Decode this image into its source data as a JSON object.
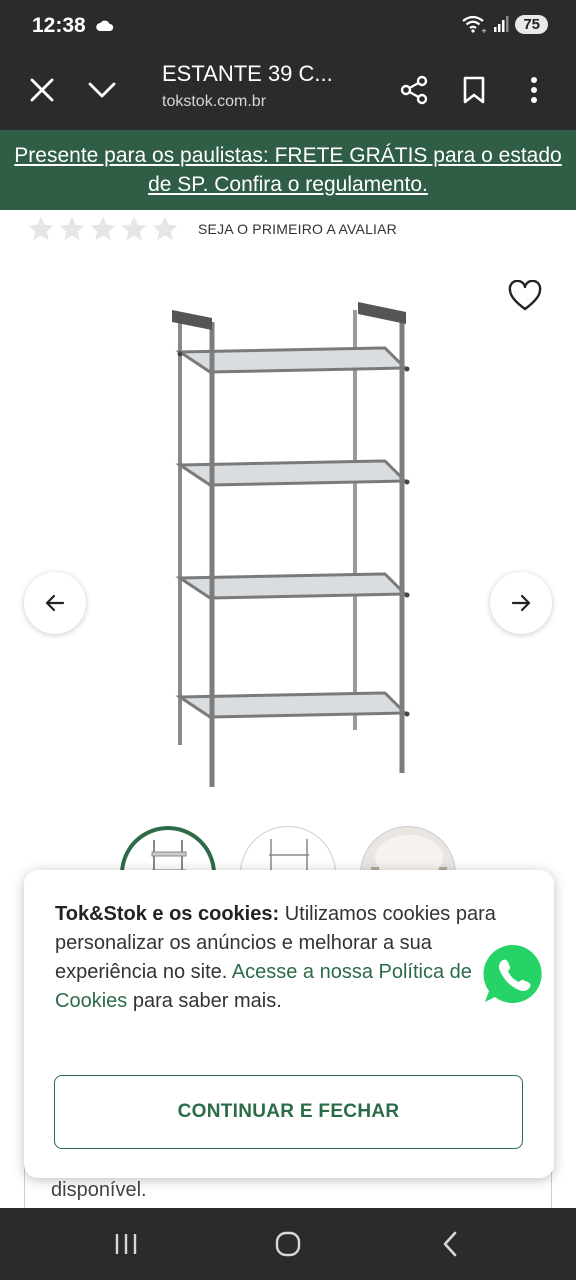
{
  "status_bar": {
    "time": "12:38",
    "battery": "75",
    "icons": [
      "cloud-icon",
      "wifi-icon",
      "signal-icon",
      "battery-icon"
    ]
  },
  "toolbar": {
    "title": "ESTANTE 39 C...",
    "url": "tokstok.com.br",
    "icons": [
      "close-icon",
      "chevron-down-icon",
      "share-icon",
      "bookmark-icon",
      "more-vert-icon"
    ]
  },
  "promo": {
    "text": "Presente para os paulistas: FRETE GRÁTIS para o estado de SP. Confira o regulamento."
  },
  "rating": {
    "stars_filled": 0,
    "stars_total": 5,
    "label": "SEJA O PRIMEIRO A AVALIAR"
  },
  "product": {
    "image_icon": "metal-glass-shelf",
    "thumbnail_count": 3,
    "active_thumbnail": 1
  },
  "cookie": {
    "title": "Tok&Stok e os cookies:",
    "text_before_link": " Utilizamos cookies para personalizar os anúncios e melhorar a sua experiência no site. ",
    "link_text": "Acesse a nossa Política de Cookies",
    "text_after_link": " para saber mais.",
    "button_label": "CONTINUAR E FECHAR"
  },
  "background_text": "disponível.",
  "colors": {
    "brand_green": "#2c6b48",
    "promo_bg": "#2f5d45",
    "toolbar_bg": "#2b2b2b",
    "whatsapp_green": "#25d366"
  }
}
